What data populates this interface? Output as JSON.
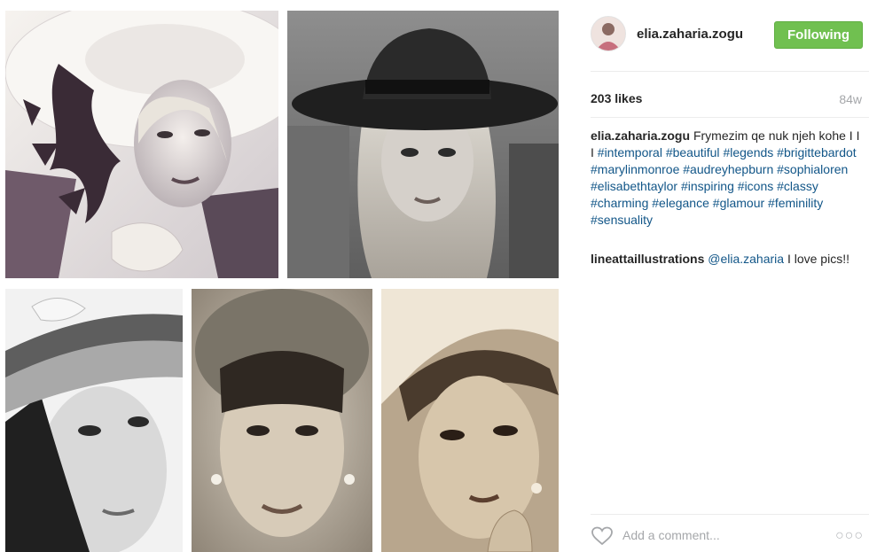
{
  "header": {
    "username": "elia.zaharia.zogu",
    "follow_label": "Following"
  },
  "stats": {
    "likes": "203 likes",
    "time_ago": "84w"
  },
  "caption": {
    "username": "elia.zaharia.zogu",
    "text": "Frymezim qe nuk njeh kohe I I I",
    "hashtags": [
      "#intemporal",
      "#beautiful",
      "#legends",
      "#brigittebardot",
      "#marylinmonroe",
      "#audreyhepburn",
      "#sophialoren",
      "#elisabethtaylor",
      "#inspiring",
      "#icons",
      "#classy",
      "#charming",
      "#elegance",
      "#glamour",
      "#feminility",
      "#sensuality"
    ]
  },
  "comment": {
    "username": "lineattaillustrations",
    "mention": "@elia.zaharia",
    "text": "I love pics!!"
  },
  "comment_box": {
    "placeholder": "Add a comment..."
  },
  "icons": {
    "like": "heart-outline-icon",
    "options": "more-options-icon"
  },
  "colors": {
    "follow_button": "#70c050",
    "hashtag": "#125688",
    "muted": "#a5a7aa"
  }
}
